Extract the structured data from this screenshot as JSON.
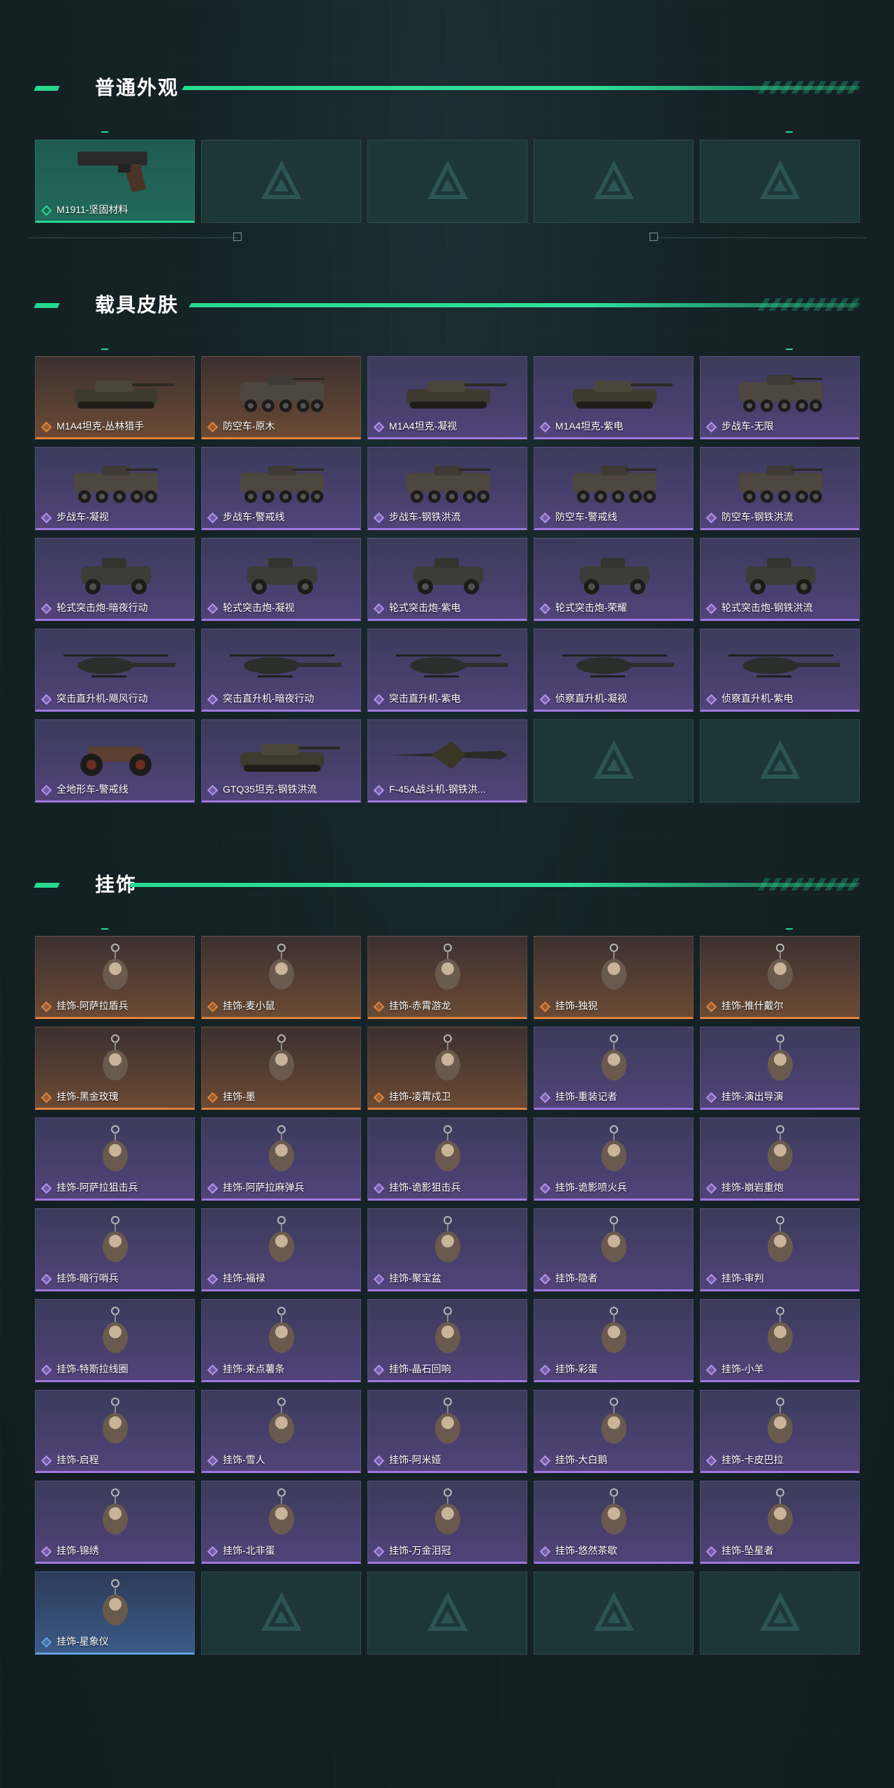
{
  "sections": [
    {
      "title": "普通外观",
      "items": [
        {
          "label": "M1911-坚固材料",
          "rarity": "green",
          "art": "pistol"
        }
      ],
      "empty_slots": 4
    },
    {
      "title": "载具皮肤",
      "items": [
        {
          "label": "M1A4坦克-丛林猎手",
          "rarity": "orange",
          "art": "tank"
        },
        {
          "label": "防空车-原木",
          "rarity": "orange",
          "art": "apc"
        },
        {
          "label": "M1A4坦克-凝视",
          "rarity": "purple",
          "art": "tank"
        },
        {
          "label": "M1A4坦克-紫电",
          "rarity": "purple",
          "art": "tank"
        },
        {
          "label": "步战车-无限",
          "rarity": "purple",
          "art": "apc"
        },
        {
          "label": "步战车-凝视",
          "rarity": "purple",
          "art": "apc"
        },
        {
          "label": "步战车-警戒线",
          "rarity": "purple",
          "art": "apc"
        },
        {
          "label": "步战车-钢铁洪流",
          "rarity": "purple",
          "art": "apc"
        },
        {
          "label": "防空车-警戒线",
          "rarity": "purple",
          "art": "apc"
        },
        {
          "label": "防空车-钢铁洪流",
          "rarity": "purple",
          "art": "apc"
        },
        {
          "label": "轮式突击炮-暗夜行动",
          "rarity": "purple",
          "art": "jeep"
        },
        {
          "label": "轮式突击炮-凝视",
          "rarity": "purple",
          "art": "jeep"
        },
        {
          "label": "轮式突击炮-紫电",
          "rarity": "purple",
          "art": "jeep"
        },
        {
          "label": "轮式突击炮-荣耀",
          "rarity": "purple",
          "art": "jeep"
        },
        {
          "label": "轮式突击炮-钢铁洪流",
          "rarity": "purple",
          "art": "jeep"
        },
        {
          "label": "突击直升机-飓风行动",
          "rarity": "purple",
          "art": "heli"
        },
        {
          "label": "突击直升机-暗夜行动",
          "rarity": "purple",
          "art": "heli"
        },
        {
          "label": "突击直升机-紫电",
          "rarity": "purple",
          "art": "heli"
        },
        {
          "label": "侦察直升机-凝视",
          "rarity": "purple",
          "art": "heli"
        },
        {
          "label": "侦察直升机-紫电",
          "rarity": "purple",
          "art": "heli"
        },
        {
          "label": "全地形车-警戒线",
          "rarity": "purple",
          "art": "atv"
        },
        {
          "label": "GTQ35坦克-钢铁洪流",
          "rarity": "purple",
          "art": "tank"
        },
        {
          "label": "F-45A战斗机-钢铁洪...",
          "rarity": "purple",
          "art": "jet"
        }
      ],
      "empty_slots": 2
    },
    {
      "title": "挂饰",
      "items": [
        {
          "label": "挂饰-阿萨拉盾兵",
          "rarity": "orange",
          "art": "charm"
        },
        {
          "label": "挂饰-麦小鼠",
          "rarity": "orange",
          "art": "charm"
        },
        {
          "label": "挂饰-赤霄游龙",
          "rarity": "orange",
          "art": "charm"
        },
        {
          "label": "挂饰-独猊",
          "rarity": "orange",
          "art": "charm"
        },
        {
          "label": "挂饰-推什戴尔",
          "rarity": "orange",
          "art": "charm"
        },
        {
          "label": "挂饰-黑金玫瑰",
          "rarity": "orange",
          "art": "charm"
        },
        {
          "label": "挂饰-墨",
          "rarity": "orange",
          "art": "charm"
        },
        {
          "label": "挂饰-凌霄戍卫",
          "rarity": "orange",
          "art": "charm"
        },
        {
          "label": "挂饰-重装记者",
          "rarity": "purple",
          "art": "charm"
        },
        {
          "label": "挂饰-演出导演",
          "rarity": "purple",
          "art": "charm"
        },
        {
          "label": "挂饰-阿萨拉狙击兵",
          "rarity": "purple",
          "art": "charm"
        },
        {
          "label": "挂饰-阿萨拉麻弹兵",
          "rarity": "purple",
          "art": "charm"
        },
        {
          "label": "挂饰-诡影狙击兵",
          "rarity": "purple",
          "art": "charm"
        },
        {
          "label": "挂饰-诡影喷火兵",
          "rarity": "purple",
          "art": "charm"
        },
        {
          "label": "挂饰-崩岩重炮",
          "rarity": "purple",
          "art": "charm"
        },
        {
          "label": "挂饰-暗行哨兵",
          "rarity": "purple",
          "art": "charm"
        },
        {
          "label": "挂饰-福禄",
          "rarity": "purple",
          "art": "charm"
        },
        {
          "label": "挂饰-聚宝盆",
          "rarity": "purple",
          "art": "charm"
        },
        {
          "label": "挂饰-隐者",
          "rarity": "purple",
          "art": "charm"
        },
        {
          "label": "挂饰-审判",
          "rarity": "purple",
          "art": "charm"
        },
        {
          "label": "挂饰-特斯拉线圈",
          "rarity": "purple",
          "art": "charm"
        },
        {
          "label": "挂饰-来点薯条",
          "rarity": "purple",
          "art": "charm"
        },
        {
          "label": "挂饰-晶石回响",
          "rarity": "purple",
          "art": "charm"
        },
        {
          "label": "挂饰-彩蛋",
          "rarity": "purple",
          "art": "charm"
        },
        {
          "label": "挂饰-小羊",
          "rarity": "purple",
          "art": "charm"
        },
        {
          "label": "挂饰-启程",
          "rarity": "purple",
          "art": "charm"
        },
        {
          "label": "挂饰-雪人",
          "rarity": "purple",
          "art": "charm"
        },
        {
          "label": "挂饰-阿米娅",
          "rarity": "purple",
          "art": "charm"
        },
        {
          "label": "挂饰-大白鹅",
          "rarity": "purple",
          "art": "charm"
        },
        {
          "label": "挂饰-卡皮巴拉",
          "rarity": "purple",
          "art": "charm"
        },
        {
          "label": "挂饰-锦绣",
          "rarity": "purple",
          "art": "charm"
        },
        {
          "label": "挂饰-北非蛋",
          "rarity": "purple",
          "art": "charm"
        },
        {
          "label": "挂饰-万金泪冠",
          "rarity": "purple",
          "art": "charm"
        },
        {
          "label": "挂饰-悠然茶歇",
          "rarity": "purple",
          "art": "charm"
        },
        {
          "label": "挂饰-坠星者",
          "rarity": "purple",
          "art": "charm"
        },
        {
          "label": "挂饰-星象仪",
          "rarity": "blue",
          "art": "charm"
        }
      ],
      "empty_slots": 4
    }
  ],
  "colors": {
    "accent": "#27d98f",
    "orange": "#e2823a",
    "purple": "#9f77e0",
    "blue": "#61a2e8",
    "empty": "#1d3637"
  }
}
